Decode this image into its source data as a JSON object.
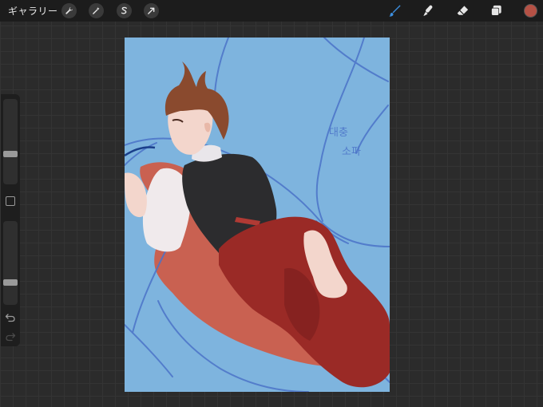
{
  "toolbar": {
    "gallery_label": "ギャラリー",
    "left_tools": [
      {
        "name": "actions",
        "icon": "wrench-icon"
      },
      {
        "name": "adjustments",
        "icon": "magic-wand-icon"
      },
      {
        "name": "selection",
        "icon": "selection-s-icon"
      },
      {
        "name": "transform",
        "icon": "arrow-cursor-icon"
      }
    ],
    "right_tools": [
      {
        "name": "brush",
        "icon": "brush-icon",
        "active": true
      },
      {
        "name": "smudge",
        "icon": "smudge-icon",
        "active": false
      },
      {
        "name": "eraser",
        "icon": "eraser-icon",
        "active": false
      },
      {
        "name": "layers",
        "icon": "layers-icon",
        "active": false
      }
    ],
    "active_tool_color": "#3d8fe0",
    "current_color": "#b55145"
  },
  "sidebar": {
    "brush_size_level": 0.34,
    "opacity_level": 0.25,
    "modify_icon": "square-icon",
    "undo_icon": "undo-arrow-icon",
    "redo_icon": "redo-arrow-icon"
  },
  "canvas": {
    "background_color": "#7eb4de",
    "handwritten_text_lines": [
      "대충",
      "소파"
    ],
    "sketch_color": "#4b73c8",
    "shadow_color": "#d4553e",
    "pants_color": "#9a2a26",
    "vest_color": "#2c2c2e",
    "hair_color": "#8a4a2e",
    "skin_color": "#f3d6cc"
  }
}
